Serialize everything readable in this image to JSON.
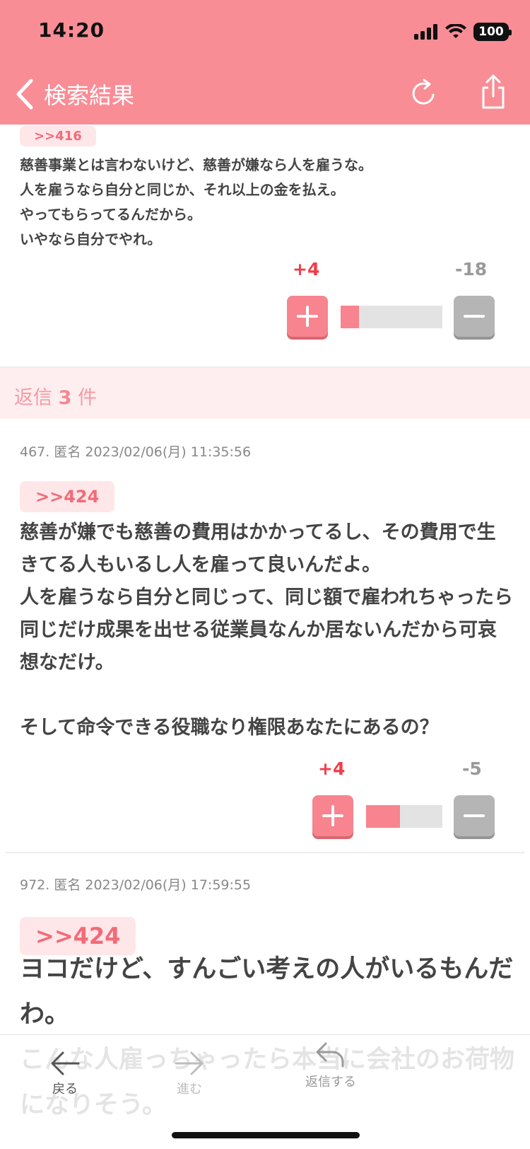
{
  "status_bar": {
    "time": "14:20",
    "battery": "100"
  },
  "nav": {
    "back_label": "検索結果"
  },
  "post1": {
    "ref": ">>416",
    "text": "慈善事業とは言わないけど、慈善が嫌なら人を雇うな。\n人を雇うなら自分と同じか、それ以上の金を払え。\nやってもらってるんだから。\nいやなら自分でやれ。",
    "plus": "+4",
    "minus": "-18",
    "plus_ratio": 0.18
  },
  "reply_banner": {
    "prefix": "返信",
    "count": "3",
    "suffix": "件"
  },
  "post2": {
    "meta": "467. 匿名 2023/02/06(月) 11:35:56",
    "ref": ">>424",
    "text": "慈善が嫌でも慈善の費用はかかってるし、その費用で生きてる人もいるし人を雇って良いんだよ。\n人を雇うなら自分と同じって、同じ額で雇われちゃったら同じだけ成果を出せる従業員なんか居ないんだから可哀想なだけ。\n\nそして命令できる役職なり権限あなたにあるの？",
    "plus": "+4",
    "minus": "-5",
    "plus_ratio": 0.44
  },
  "post3": {
    "meta": "972. 匿名 2023/02/06(月) 17:59:55",
    "ref": ">>424",
    "text": "ヨコだけど、すんごい考えの人がいるもんだわ。\nこんな人雇っちゃったら本当に会社のお荷物になりそう。"
  },
  "toolbar": {
    "back": "戻る",
    "forward": "進む",
    "reply": "返信する"
  },
  "colors": {
    "header": "#f98d96",
    "accent": "#f7848e",
    "plus_text": "#ef3e4b"
  }
}
